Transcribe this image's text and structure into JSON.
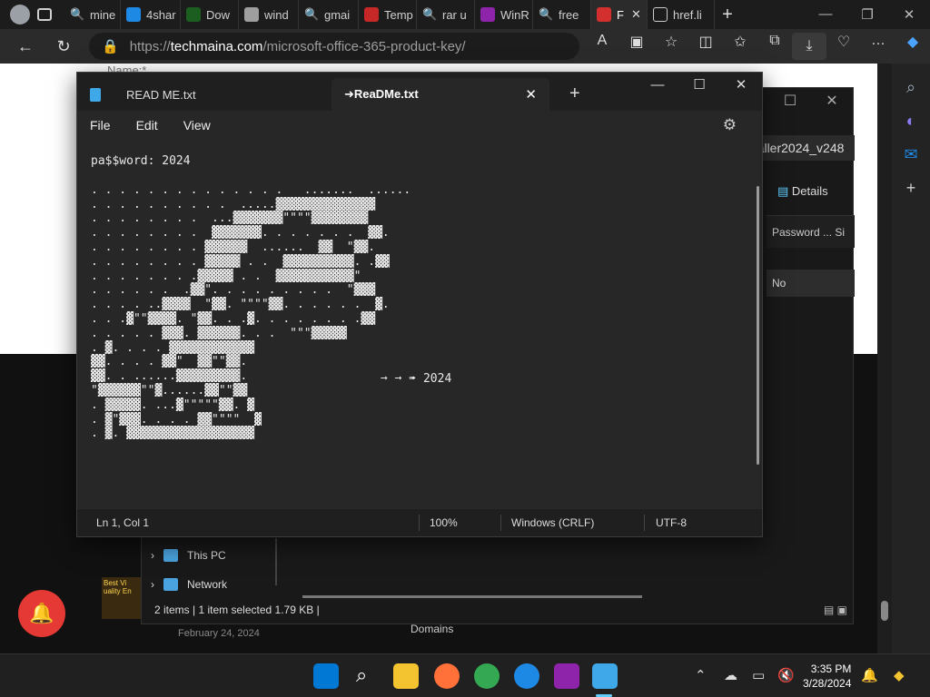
{
  "browser": {
    "tabs": [
      {
        "label": "mine"
      },
      {
        "label": "4shar"
      },
      {
        "label": "Dow"
      },
      {
        "label": "wind"
      },
      {
        "label": "gmai"
      },
      {
        "label": "Temp"
      },
      {
        "label": "rar u"
      },
      {
        "label": "WinR"
      },
      {
        "label": "free"
      },
      {
        "label": "F"
      },
      {
        "label": "href.li"
      }
    ],
    "url_protocol": "https://",
    "url_host": "techmaina.com",
    "url_path": "/microsoft-office-365-product-key/"
  },
  "page": {
    "name_field_label": "Name:*",
    "domains_text": "Domains",
    "date_text": "February 24, 2024",
    "promo_text": "Best Vi uality En"
  },
  "explorer": {
    "address_text": "$taller2024_v248",
    "details_label": "Details",
    "column_header": "Password ...",
    "column_header2": "Si",
    "cell_value": "No",
    "nav_this_pc": "This PC",
    "nav_network": "Network",
    "status_items": "2 items",
    "status_selected": "1 item selected  1.79 KB"
  },
  "notepad": {
    "tab1_label": "READ ME.txt",
    "tab2_label": "➜ReaDMe.txt",
    "menu_file": "File",
    "menu_edit": "Edit",
    "menu_view": "View",
    "password_line": "pa$$word: 2024",
    "ascii_art": ". . . . . . . . . . . . . .   .......  ......\n. . . . . . . . . .  .....▓▓▓▓▓▓▓▓▓▓▓▓▓▓\n. . . . . . . .  ...▓▓▓▓▓▓▓\"\"\"\"▓▓▓▓▓▓▓▓\n. . . . . . . .  ▓▓▓▓▓▓▓. . . . . . .  ▓▓.\n. . . . . . . . ▓▓▓▓▓▓  ......  ▓▓  \"▓▓.\n. . . . . . . . ▓▓▓▓▓ . .  ▓▓▓▓▓▓▓▓▓▓. .▓▓\n. . . . . . . .▓▓▓▓▓ . .  ▓▓▓▓▓▓▓▓▓▓▓\"\n. . . . . .  .▓▓\". . . . . . . . .  \"▓▓▓\n. . . . ..▓▓▓▓  \"▓▓. \"\"\"\"▓▓. . . . . .  ▓.\n. . .▓\"\"▓▓▓▓. \"▓▓. . .▓. . . . . . . .▓▓\n. . . . . ▓▓▓. ▓▓▓▓▓▓. . .  \"\"\"▓▓▓▓▓\n. ▓. . . . ▓▓▓▓▓▓▓▓▓▓▓▓\n▓▓. . . . ▓▓\"  ▓▓\"\"▓▓.\n▓▓. . ......▓▓▓▓▓▓▓▓▓.\n\"▓▓▓▓▓▓\"\"▓......▓▓\"\"▓▓\n. ▓▓▓▓▓. ...▓\"\"\"\"\"▓▓. ▓\n. ▓\"▓▓▓. . . . ▓▓\"\"\"\"  ▓\n. ▓. ▓▓▓▓▓▓▓▓▓▓▓▓▓▓▓▓▓▓",
    "arrow_text": "➞ ➞ ➠ 2024",
    "status_position": "Ln 1, Col 1",
    "status_zoom": "100%",
    "status_lineending": "Windows (CRLF)",
    "status_encoding": "UTF-8"
  },
  "taskbar": {
    "time": "3:35 PM",
    "date": "3/28/2024"
  }
}
